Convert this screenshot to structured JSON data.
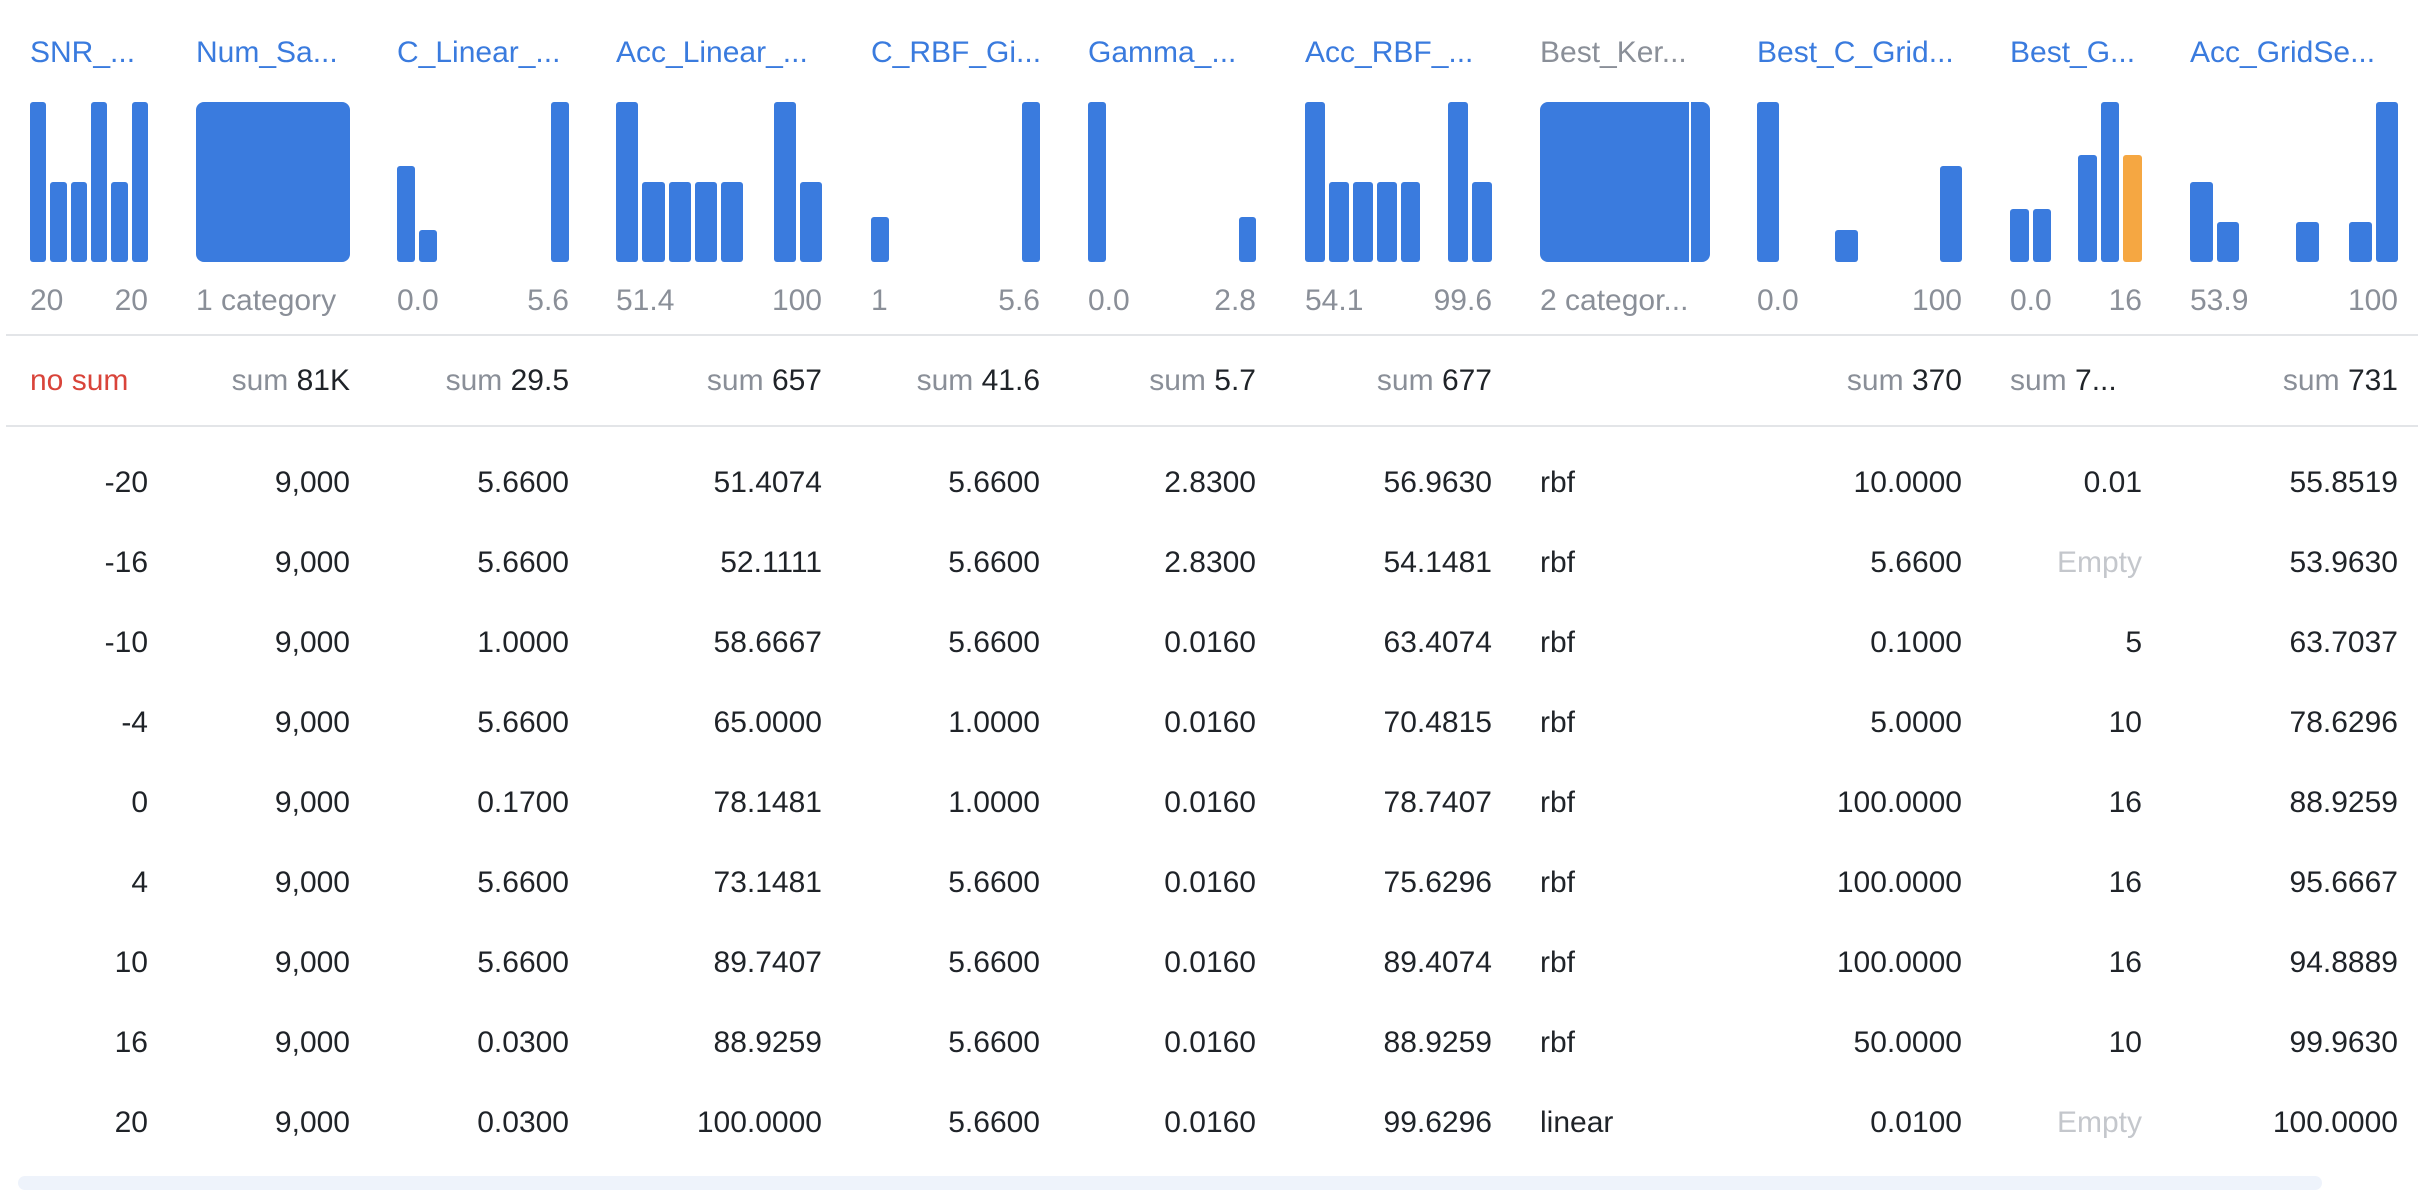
{
  "columns": [
    {
      "key": "snr",
      "header": "SNR_...",
      "range_lo": "20",
      "range_hi": "20",
      "sum_label": "",
      "sum_value": "no sum",
      "hist": [
        100,
        50,
        50,
        100,
        50,
        100
      ],
      "hl": -1,
      "kind": "num"
    },
    {
      "key": "num_samples",
      "header": "Num_Sa...",
      "category": "1 category",
      "sum_label": "sum",
      "sum_value": "81K",
      "kind": "cat1"
    },
    {
      "key": "c_linear",
      "header": "C_Linear_...",
      "range_lo": "0.0",
      "range_hi": "5.6",
      "sum_label": "sum",
      "sum_value": "29.5",
      "hist": [
        60,
        20,
        0,
        0,
        0,
        0,
        0,
        100
      ],
      "hl": -1,
      "kind": "num"
    },
    {
      "key": "acc_linear",
      "header": "Acc_Linear_...",
      "range_lo": "51.4",
      "range_hi": "100",
      "sum_label": "sum",
      "sum_value": "657",
      "hist": [
        100,
        50,
        50,
        50,
        50,
        0,
        100,
        50
      ],
      "hl": -1,
      "kind": "num"
    },
    {
      "key": "c_rbf",
      "header": "C_RBF_Gi...",
      "range_lo": "1",
      "range_hi": "5.6",
      "sum_label": "sum",
      "sum_value": "41.6",
      "hist": [
        28,
        0,
        0,
        0,
        0,
        0,
        0,
        100
      ],
      "hl": -1,
      "kind": "num"
    },
    {
      "key": "gamma",
      "header": "Gamma_...",
      "range_lo": "0.0",
      "range_hi": "2.8",
      "sum_label": "sum",
      "sum_value": "5.7",
      "hist": [
        100,
        0,
        0,
        0,
        0,
        0,
        0,
        28
      ],
      "hl": -1,
      "kind": "num"
    },
    {
      "key": "acc_rbf",
      "header": "Acc_RBF_...",
      "range_lo": "54.1",
      "range_hi": "99.6",
      "sum_label": "sum",
      "sum_value": "677",
      "hist": [
        100,
        50,
        50,
        50,
        50,
        0,
        100,
        50
      ],
      "hl": -1,
      "kind": "num"
    },
    {
      "key": "best_kernel",
      "header": "Best_Ker...",
      "category": "2 categor...",
      "sum_label": "",
      "sum_value": "",
      "kind": "cat2"
    },
    {
      "key": "best_c",
      "header": "Best_C_Grid...",
      "range_lo": "0.0",
      "range_hi": "100",
      "sum_label": "sum",
      "sum_value": "370",
      "hist": [
        100,
        0,
        0,
        20,
        0,
        0,
        0,
        60
      ],
      "hl": -1,
      "kind": "num"
    },
    {
      "key": "best_gamma",
      "header": "Best_G...",
      "range_lo": "0.0",
      "range_hi": "16",
      "sum_label": "sum",
      "sum_value": "7...",
      "hist": [
        33,
        33,
        0,
        67,
        100,
        67
      ],
      "hl": 5,
      "kind": "num"
    },
    {
      "key": "acc_grid",
      "header": "Acc_GridSe...",
      "range_lo": "53.9",
      "range_hi": "100",
      "sum_label": "sum",
      "sum_value": "731",
      "hist": [
        50,
        25,
        0,
        0,
        25,
        0,
        25,
        100
      ],
      "hl": -1,
      "kind": "num"
    }
  ],
  "rows": [
    {
      "snr": "-20",
      "num_samples": "9,000",
      "c_linear": "5.6600",
      "acc_linear": "51.4074",
      "c_rbf": "5.6600",
      "gamma": "2.8300",
      "acc_rbf": "56.9630",
      "best_kernel": "rbf",
      "best_c": "10.0000",
      "best_gamma": "0.01",
      "acc_grid": "55.8519"
    },
    {
      "snr": "-16",
      "num_samples": "9,000",
      "c_linear": "5.6600",
      "acc_linear": "52.1111",
      "c_rbf": "5.6600",
      "gamma": "2.8300",
      "acc_rbf": "54.1481",
      "best_kernel": "rbf",
      "best_c": "5.6600",
      "best_gamma": "Empty",
      "acc_grid": "53.9630"
    },
    {
      "snr": "-10",
      "num_samples": "9,000",
      "c_linear": "1.0000",
      "acc_linear": "58.6667",
      "c_rbf": "5.6600",
      "gamma": "0.0160",
      "acc_rbf": "63.4074",
      "best_kernel": "rbf",
      "best_c": "0.1000",
      "best_gamma": "5",
      "acc_grid": "63.7037"
    },
    {
      "snr": "-4",
      "num_samples": "9,000",
      "c_linear": "5.6600",
      "acc_linear": "65.0000",
      "c_rbf": "1.0000",
      "gamma": "0.0160",
      "acc_rbf": "70.4815",
      "best_kernel": "rbf",
      "best_c": "5.0000",
      "best_gamma": "10",
      "acc_grid": "78.6296"
    },
    {
      "snr": "0",
      "num_samples": "9,000",
      "c_linear": "0.1700",
      "acc_linear": "78.1481",
      "c_rbf": "1.0000",
      "gamma": "0.0160",
      "acc_rbf": "78.7407",
      "best_kernel": "rbf",
      "best_c": "100.0000",
      "best_gamma": "16",
      "acc_grid": "88.9259"
    },
    {
      "snr": "4",
      "num_samples": "9,000",
      "c_linear": "5.6600",
      "acc_linear": "73.1481",
      "c_rbf": "5.6600",
      "gamma": "0.0160",
      "acc_rbf": "75.6296",
      "best_kernel": "rbf",
      "best_c": "100.0000",
      "best_gamma": "16",
      "acc_grid": "95.6667"
    },
    {
      "snr": "10",
      "num_samples": "9,000",
      "c_linear": "5.6600",
      "acc_linear": "89.7407",
      "c_rbf": "5.6600",
      "gamma": "0.0160",
      "acc_rbf": "89.4074",
      "best_kernel": "rbf",
      "best_c": "100.0000",
      "best_gamma": "16",
      "acc_grid": "94.8889"
    },
    {
      "snr": "16",
      "num_samples": "9,000",
      "c_linear": "0.0300",
      "acc_linear": "88.9259",
      "c_rbf": "5.6600",
      "gamma": "0.0160",
      "acc_rbf": "88.9259",
      "best_kernel": "rbf",
      "best_c": "50.0000",
      "best_gamma": "10",
      "acc_grid": "99.9630"
    },
    {
      "snr": "20",
      "num_samples": "9,000",
      "c_linear": "0.0300",
      "acc_linear": "100.0000",
      "c_rbf": "5.6600",
      "gamma": "0.0160",
      "acc_rbf": "99.6296",
      "best_kernel": "linear",
      "best_c": "0.0100",
      "best_gamma": "Empty",
      "acc_grid": "100.0000"
    }
  ],
  "colors": {
    "accent": "#3a7bde",
    "highlight": "#f5a742",
    "muted": "#8a8f98",
    "nosum": "#d9443a",
    "empty": "#c4c7cc"
  }
}
